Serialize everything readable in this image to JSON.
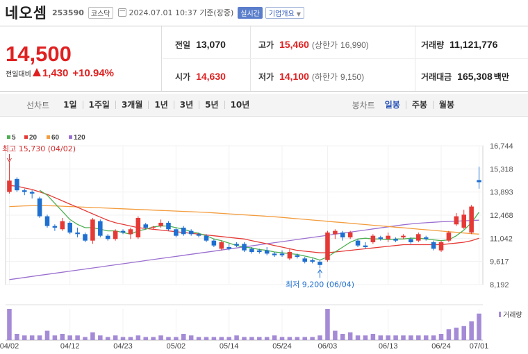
{
  "header": {
    "name": "네오셈",
    "code": "253590",
    "market": "코스닥",
    "asof": "2024.07.01 10:37  기준(장중)",
    "realtime": "실시간",
    "company_info": "기업개요"
  },
  "quote": {
    "price": "14,500",
    "change_label": "전일대비",
    "change": "1,430",
    "change_pct": "+10.94%",
    "prev_label": "전일",
    "prev": "13,070",
    "high_label": "고가",
    "high": "15,460",
    "upper_label": "(상한가",
    "upper": "16,990)",
    "volume_label": "거래량",
    "volume": "11,121,776",
    "open_label": "시가",
    "open": "14,630",
    "low_label": "저가",
    "low": "14,100",
    "lower_label": "(하한가",
    "lower": "9,150)",
    "amount_label": "거래대금",
    "amount": "165,308",
    "amount_unit": "백만"
  },
  "periods": {
    "label": "선차트",
    "items": [
      "1일",
      "1주일",
      "3개월",
      "1년",
      "3년",
      "5년",
      "10년"
    ]
  },
  "candle_types": {
    "label": "봉차트",
    "items": [
      "일봉",
      "주봉",
      "월봉"
    ],
    "active": "일봉"
  },
  "chart_data": {
    "type": "candlestick",
    "legend": [
      {
        "name": "5",
        "color": "#4caf50"
      },
      {
        "name": "20",
        "color": "#e53935"
      },
      {
        "name": "60",
        "color": "#f39c3d"
      },
      {
        "name": "120",
        "color": "#9b6fd0"
      }
    ],
    "y_ticks": [
      8192,
      9617,
      11042,
      12468,
      13893,
      15318,
      16744
    ],
    "y_tick_labels": [
      "8,192",
      "9,617",
      "11,042",
      "12,468",
      "13,893",
      "15,318",
      "16,744"
    ],
    "x_labels": [
      {
        "i": 0,
        "label": "04/02"
      },
      {
        "i": 8,
        "label": "04/12"
      },
      {
        "i": 15,
        "label": "04/23"
      },
      {
        "i": 22,
        "label": "05/02"
      },
      {
        "i": 29,
        "label": "05/14"
      },
      {
        "i": 36,
        "label": "05/24"
      },
      {
        "i": 42,
        "label": "06/03"
      },
      {
        "i": 50,
        "label": "06/13"
      },
      {
        "i": 57,
        "label": "06/24"
      },
      {
        "i": 62,
        "label": "07/01"
      }
    ],
    "high_annotation": "최고 15,730 (04/02)",
    "low_annotation": "최저 9,200 (06/04)",
    "volume_label": "거래량",
    "up_color": "#e53935",
    "down_color": "#1e6fd0",
    "volume_color": "#a58bd6",
    "candles": [
      {
        "o": 13900,
        "h": 15730,
        "l": 13800,
        "c": 14600
      },
      {
        "o": 14700,
        "h": 14800,
        "l": 13900,
        "c": 14000
      },
      {
        "o": 14000,
        "h": 14100,
        "l": 13700,
        "c": 13900
      },
      {
        "o": 13900,
        "h": 14000,
        "l": 13500,
        "c": 13800
      },
      {
        "o": 13500,
        "h": 13600,
        "l": 12300,
        "c": 12400
      },
      {
        "o": 12400,
        "h": 12500,
        "l": 11700,
        "c": 11800
      },
      {
        "o": 11800,
        "h": 11900,
        "l": 11500,
        "c": 11700
      },
      {
        "o": 11600,
        "h": 12300,
        "l": 11500,
        "c": 12100
      },
      {
        "o": 12000,
        "h": 12100,
        "l": 11300,
        "c": 11400
      },
      {
        "o": 11400,
        "h": 11700,
        "l": 11100,
        "c": 11300
      },
      {
        "o": 11300,
        "h": 11400,
        "l": 10800,
        "c": 10900
      },
      {
        "o": 10900,
        "h": 12300,
        "l": 10700,
        "c": 12200
      },
      {
        "o": 12100,
        "h": 12200,
        "l": 11100,
        "c": 11200
      },
      {
        "o": 11200,
        "h": 11300,
        "l": 10900,
        "c": 11000
      },
      {
        "o": 11000,
        "h": 11600,
        "l": 10900,
        "c": 11500
      },
      {
        "o": 11500,
        "h": 11600,
        "l": 11300,
        "c": 11400
      },
      {
        "o": 11300,
        "h": 11700,
        "l": 11000,
        "c": 11600
      },
      {
        "o": 11100,
        "h": 12400,
        "l": 11000,
        "c": 12300
      },
      {
        "o": 11900,
        "h": 12000,
        "l": 11600,
        "c": 11700
      },
      {
        "o": 11700,
        "h": 11800,
        "l": 11600,
        "c": 11750
      },
      {
        "o": 11800,
        "h": 12200,
        "l": 11700,
        "c": 12000
      },
      {
        "o": 12000,
        "h": 12100,
        "l": 11500,
        "c": 11600
      },
      {
        "o": 11600,
        "h": 11700,
        "l": 11100,
        "c": 11200
      },
      {
        "o": 11700,
        "h": 11800,
        "l": 11200,
        "c": 11300
      },
      {
        "o": 11500,
        "h": 11600,
        "l": 11200,
        "c": 11300
      },
      {
        "o": 11300,
        "h": 11400,
        "l": 11100,
        "c": 11200
      },
      {
        "o": 11200,
        "h": 11300,
        "l": 10800,
        "c": 10900
      },
      {
        "o": 10900,
        "h": 11000,
        "l": 10500,
        "c": 10600
      },
      {
        "o": 10400,
        "h": 10900,
        "l": 10300,
        "c": 10800
      },
      {
        "o": 10500,
        "h": 10700,
        "l": 10300,
        "c": 10400
      },
      {
        "o": 10700,
        "h": 10800,
        "l": 10500,
        "c": 10600
      },
      {
        "o": 10700,
        "h": 10800,
        "l": 10200,
        "c": 10300
      },
      {
        "o": 10400,
        "h": 10500,
        "l": 10100,
        "c": 10200
      },
      {
        "o": 10300,
        "h": 10400,
        "l": 10100,
        "c": 10200
      },
      {
        "o": 10300,
        "h": 10500,
        "l": 10000,
        "c": 10100
      },
      {
        "o": 10100,
        "h": 10200,
        "l": 9900,
        "c": 10000
      },
      {
        "o": 10100,
        "h": 10300,
        "l": 9900,
        "c": 10000
      },
      {
        "o": 9800,
        "h": 10400,
        "l": 9700,
        "c": 10200
      },
      {
        "o": 10000,
        "h": 10100,
        "l": 9800,
        "c": 9900
      },
      {
        "o": 9800,
        "h": 9900,
        "l": 9500,
        "c": 9600
      },
      {
        "o": 9700,
        "h": 9800,
        "l": 9500,
        "c": 9600
      },
      {
        "o": 9600,
        "h": 9700,
        "l": 9200,
        "c": 9400
      },
      {
        "o": 9700,
        "h": 11500,
        "l": 9600,
        "c": 11400
      },
      {
        "o": 11300,
        "h": 11600,
        "l": 11000,
        "c": 11500
      },
      {
        "o": 11400,
        "h": 11500,
        "l": 10900,
        "c": 11100
      },
      {
        "o": 11100,
        "h": 11500,
        "l": 11000,
        "c": 11400
      },
      {
        "o": 10900,
        "h": 11000,
        "l": 10500,
        "c": 10600
      },
      {
        "o": 10600,
        "h": 10800,
        "l": 10400,
        "c": 10500
      },
      {
        "o": 10800,
        "h": 11300,
        "l": 10700,
        "c": 11200
      },
      {
        "o": 11100,
        "h": 11200,
        "l": 10900,
        "c": 11000
      },
      {
        "o": 11000,
        "h": 11400,
        "l": 10800,
        "c": 11200
      },
      {
        "o": 11000,
        "h": 11100,
        "l": 10800,
        "c": 10900
      },
      {
        "o": 11100,
        "h": 11300,
        "l": 11000,
        "c": 11200
      },
      {
        "o": 11000,
        "h": 11100,
        "l": 10700,
        "c": 10800
      },
      {
        "o": 10900,
        "h": 11400,
        "l": 10800,
        "c": 11300
      },
      {
        "o": 11100,
        "h": 11200,
        "l": 10900,
        "c": 11000
      },
      {
        "o": 10800,
        "h": 10900,
        "l": 10300,
        "c": 10400
      },
      {
        "o": 10300,
        "h": 10900,
        "l": 10200,
        "c": 10800
      },
      {
        "o": 10900,
        "h": 11500,
        "l": 10800,
        "c": 11400
      },
      {
        "o": 11900,
        "h": 12600,
        "l": 11800,
        "c": 12400
      },
      {
        "o": 11700,
        "h": 12800,
        "l": 11600,
        "c": 12500
      },
      {
        "o": 11400,
        "h": 13100,
        "l": 11300,
        "c": 13000
      },
      {
        "o": 14630,
        "h": 15460,
        "l": 14100,
        "c": 14500
      }
    ],
    "volumes": [
      20,
      4,
      3,
      3,
      3,
      6,
      3,
      4,
      3,
      3,
      2,
      5,
      3,
      2,
      3,
      2,
      2,
      3,
      2,
      2,
      3,
      2,
      2,
      4,
      3,
      2,
      2,
      2,
      2,
      2,
      3,
      2,
      2,
      2,
      2,
      3,
      2,
      2,
      2,
      2,
      2,
      3,
      20,
      6,
      4,
      5,
      3,
      3,
      4,
      3,
      3,
      3,
      3,
      3,
      3,
      3,
      3,
      4,
      7,
      8,
      9,
      12,
      17
    ],
    "ma5": [
      null,
      null,
      null,
      null,
      14000,
      13700,
      13200,
      12700,
      12200,
      11900,
      11700,
      11700,
      11600,
      11500,
      11500,
      11400,
      11300,
      11500,
      11600,
      11750,
      11800,
      11800,
      11700,
      11600,
      11450,
      11350,
      11200,
      11000,
      10900,
      10750,
      10600,
      10500,
      10450,
      10350,
      10300,
      10200,
      10150,
      10100,
      10050,
      9950,
      9850,
      9700,
      9900,
      10200,
      10500,
      10800,
      11000,
      11050,
      11000,
      11000,
      10950,
      11000,
      11000,
      11050,
      11050,
      11000,
      10950,
      10900,
      10950,
      11200,
      11550,
      12000,
      12650
    ],
    "ma20": [
      14300,
      14250,
      14150,
      14050,
      13900,
      13750,
      13550,
      13350,
      13150,
      12950,
      12750,
      12550,
      12350,
      12150,
      12000,
      11900,
      11800,
      11700,
      11650,
      11600,
      11550,
      11500,
      11450,
      11400,
      11350,
      11300,
      11250,
      11200,
      11150,
      11100,
      11050,
      11000,
      10900,
      10800,
      10700,
      10600,
      10500,
      10400,
      10300,
      10250,
      10200,
      10150,
      10150,
      10200,
      10250,
      10300,
      10350,
      10400,
      10450,
      10500,
      10550,
      10600,
      10650,
      10650,
      10650,
      10650,
      10650,
      10650,
      10700,
      10750,
      10800,
      10900,
      11050
    ],
    "ma60": [
      13000,
      13020,
      13040,
      13050,
      13050,
      13050,
      13040,
      13020,
      13000,
      12980,
      12960,
      12940,
      12920,
      12900,
      12880,
      12860,
      12840,
      12820,
      12800,
      12780,
      12760,
      12740,
      12720,
      12700,
      12680,
      12660,
      12640,
      12610,
      12580,
      12550,
      12520,
      12490,
      12460,
      12430,
      12400,
      12370,
      12330,
      12290,
      12250,
      12210,
      12170,
      12130,
      12090,
      12050,
      12010,
      11970,
      11930,
      11890,
      11850,
      11810,
      11770,
      11730,
      11690,
      11650,
      11610,
      11570,
      11530,
      11490,
      11450,
      11410,
      11370,
      11330,
      11300
    ],
    "ma120": [
      8500,
      8565,
      8630,
      8695,
      8760,
      8825,
      8890,
      8955,
      9020,
      9085,
      9150,
      9215,
      9280,
      9345,
      9410,
      9475,
      9540,
      9605,
      9670,
      9735,
      9800,
      9865,
      9930,
      9995,
      10060,
      10125,
      10190,
      10255,
      10320,
      10385,
      10450,
      10515,
      10580,
      10645,
      10710,
      10775,
      10840,
      10905,
      10970,
      11035,
      11100,
      11165,
      11230,
      11295,
      11360,
      11425,
      11490,
      11555,
      11620,
      11685,
      11750,
      11815,
      11880,
      11930,
      11970,
      12000,
      12030,
      12060,
      12080,
      12100,
      12120,
      12140,
      12160
    ]
  }
}
